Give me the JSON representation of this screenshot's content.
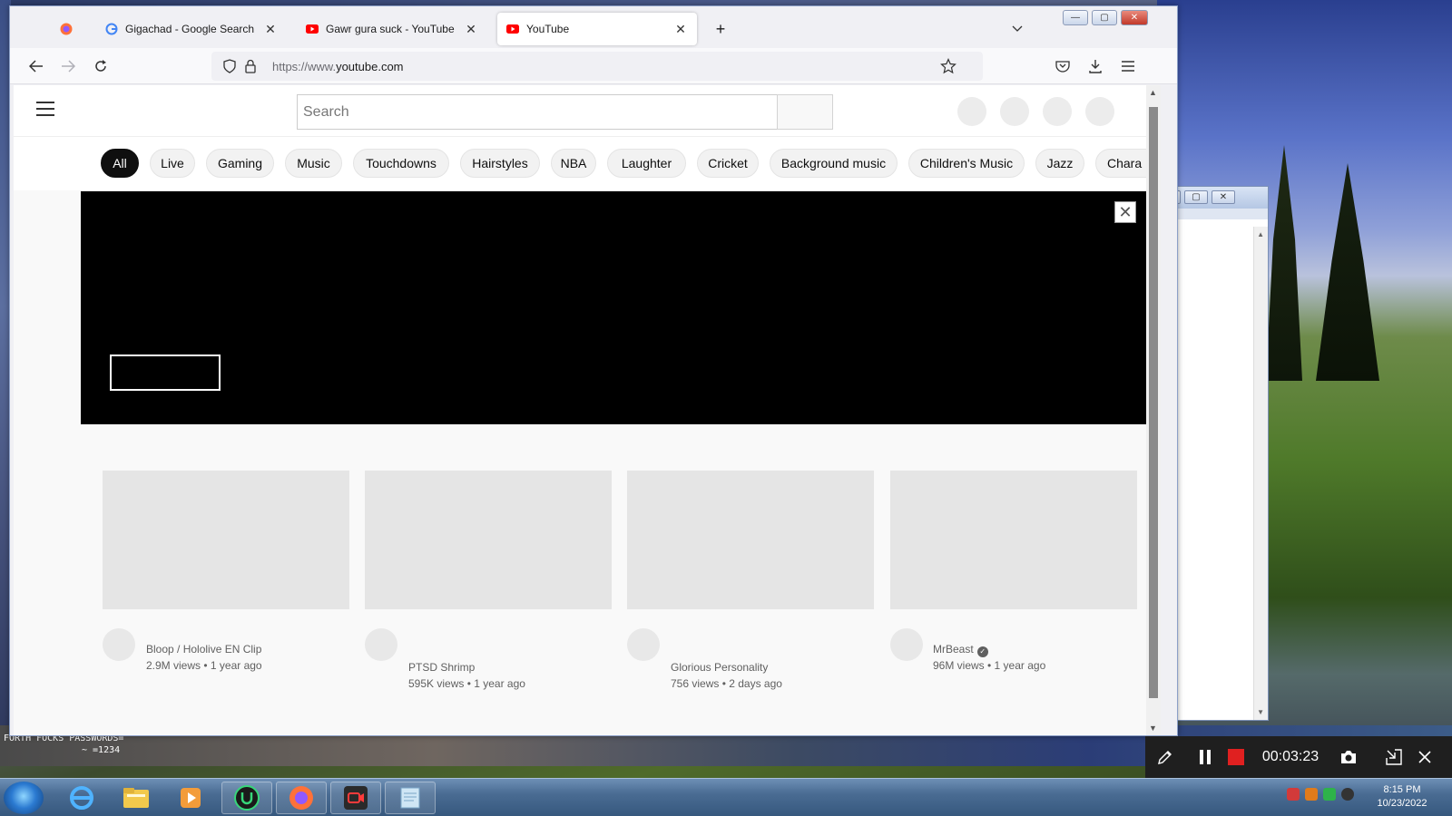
{
  "desktop": {
    "bottom_text_line1": "FORTH FOCKS PASSWORDS=",
    "bottom_text_line2": "~ =1234"
  },
  "browser": {
    "tabs": [
      {
        "label": "",
        "icon": "firefox-icon"
      },
      {
        "label": "Gigachad - Google Search",
        "icon": "google-icon"
      },
      {
        "label": "Gawr gura suck - YouTube",
        "icon": "youtube-icon"
      },
      {
        "label": "YouTube",
        "icon": "youtube-icon",
        "active": true
      }
    ],
    "close_glyph": "✕",
    "new_tab_glyph": "+",
    "url_prefix": "https://www.",
    "url_domain": "youtube.com"
  },
  "youtube": {
    "search_placeholder": "Search",
    "chips": [
      "All",
      "Live",
      "Gaming",
      "Music",
      "Touchdowns",
      "Hairstyles",
      "NBA",
      "Laughter",
      "Cricket",
      "Background music",
      "Children's Music",
      "Jazz",
      "Chara"
    ],
    "videos": [
      {
        "channel": "Bloop / Hololive EN Clip",
        "stats": "2.9M views • 1 year ago",
        "verified": false
      },
      {
        "channel": "PTSD Shrimp",
        "stats": "595K views • 1 year ago",
        "verified": false
      },
      {
        "channel": "Glorious Personality",
        "stats": "756 views • 2 days ago",
        "verified": false
      },
      {
        "channel": "MrBeast",
        "stats": "96M views • 1 year ago",
        "verified": true
      }
    ]
  },
  "recorder": {
    "timer": "00:03:23"
  },
  "taskbar": {
    "time": "8:15 PM",
    "date": "10/23/2022"
  },
  "colors": {
    "youtube_red": "#ff0000",
    "chip_active": "#0f0f0f",
    "recorder_stop": "#e02020"
  }
}
